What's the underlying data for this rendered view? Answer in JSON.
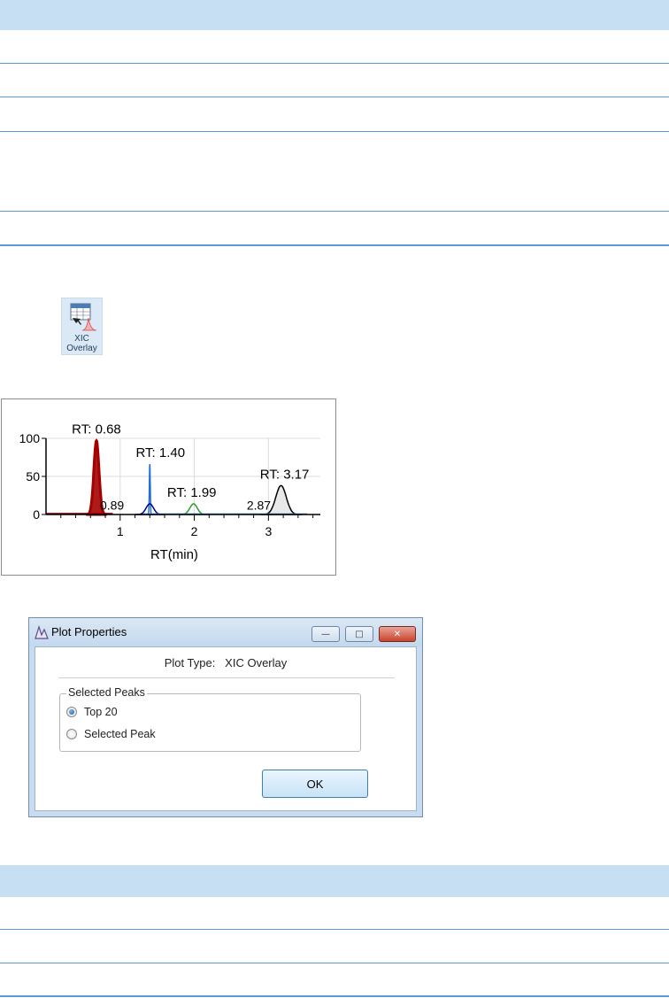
{
  "toolbar": {
    "xic_button": {
      "line1": "XIC",
      "line2": "Overlay"
    }
  },
  "chart_data": {
    "type": "line",
    "xlabel": "RT(min)",
    "xlim": [
      0,
      3.7
    ],
    "ylim": [
      0,
      100
    ],
    "x_ticks": [
      1,
      2,
      3
    ],
    "y_ticks": [
      0,
      50,
      100
    ],
    "grid": true,
    "series": [
      {
        "color": "#a50000",
        "apex_rt": 0.68,
        "apex_y": 97,
        "label": "RT: 0.68"
      },
      {
        "color": "#1f6fd6",
        "apex_rt": 1.4,
        "apex_y": 66,
        "label": "RT: 1.40"
      },
      {
        "color": "#00008b",
        "apex_rt": 1.4,
        "apex_y": 14,
        "label": ""
      },
      {
        "color": "#2e9a2e",
        "apex_rt": 1.99,
        "apex_y": 14,
        "label": "RT: 1.99"
      },
      {
        "color": "#000000",
        "apex_rt": 3.17,
        "apex_y": 38,
        "label": "RT: 3.17"
      }
    ],
    "annotations": [
      {
        "text": "0.89",
        "x": 0.89,
        "y": 4
      },
      {
        "text": "2.87",
        "x": 2.87,
        "y": 4
      }
    ]
  },
  "dialog": {
    "title": "Plot Properties",
    "plot_type_label": "Plot Type:",
    "plot_type_value": "XIC Overlay",
    "group_title": "Selected Peaks",
    "options": [
      {
        "label": "Top 20",
        "selected": true
      },
      {
        "label": "Selected Peak",
        "selected": false
      }
    ],
    "ok_label": "OK",
    "minimize_glyph": "—",
    "maximize_glyph": "□",
    "close_glyph": "✕"
  }
}
